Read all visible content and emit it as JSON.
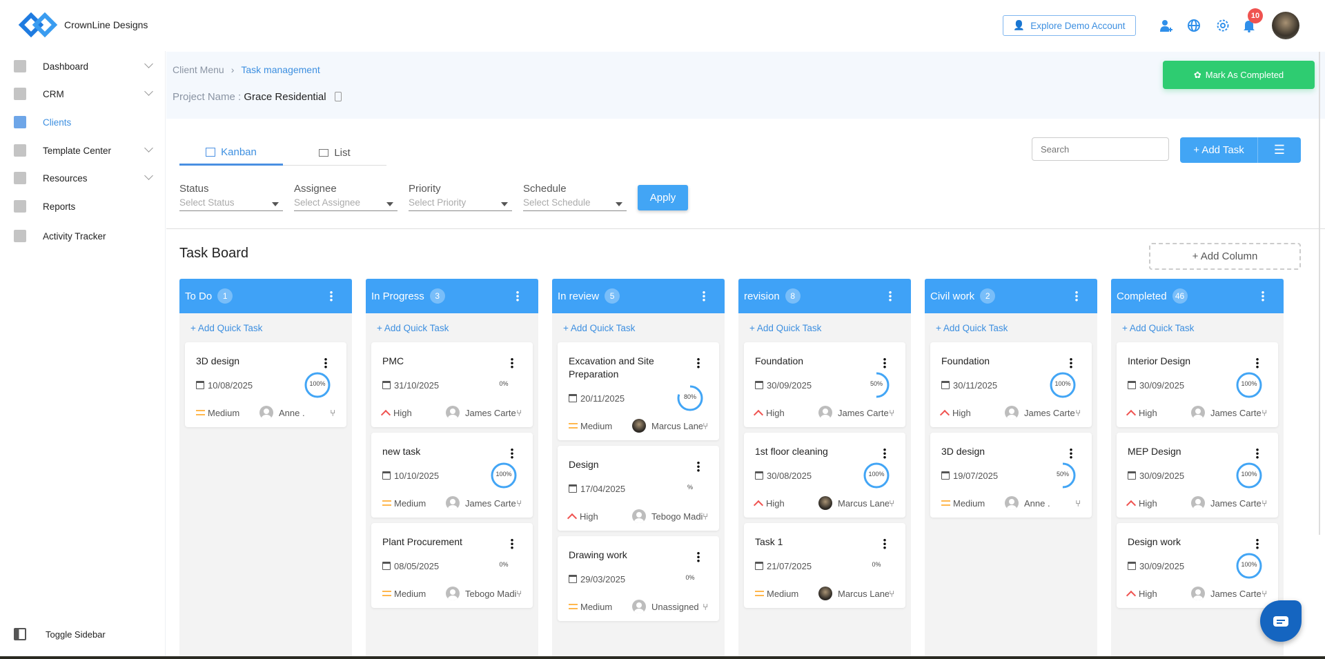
{
  "header": {
    "brand": "CrownLine Designs",
    "demo_button": "Explore Demo Account",
    "notification_count": "10"
  },
  "sidebar": {
    "items": [
      {
        "label": "Dashboard",
        "chevron": true
      },
      {
        "label": "CRM",
        "chevron": true
      },
      {
        "label": "Clients",
        "chevron": false,
        "active": true
      },
      {
        "label": "Template Center",
        "chevron": true
      },
      {
        "label": "Resources",
        "chevron": true
      },
      {
        "label": "Reports",
        "chevron": false
      },
      {
        "label": "Activity Tracker",
        "chevron": false
      }
    ],
    "toggle": "Toggle Sidebar"
  },
  "breadcrumb": {
    "parent": "Client Menu",
    "current": "Task management"
  },
  "project": {
    "label": "Project Name :",
    "name": "Grace Residential"
  },
  "mark_completed": "Mark As Completed",
  "tabs": [
    {
      "label": "Kanban",
      "active": true
    },
    {
      "label": "List",
      "active": false
    }
  ],
  "filters": [
    {
      "label": "Status",
      "placeholder": "Select Status"
    },
    {
      "label": "Assignee",
      "placeholder": "Select Assignee"
    },
    {
      "label": "Priority",
      "placeholder": "Select Priority"
    },
    {
      "label": "Schedule",
      "placeholder": "Select Schedule"
    }
  ],
  "apply": "Apply",
  "search": {
    "placeholder": "Search"
  },
  "add_task": "+ Add Task",
  "board": {
    "title": "Task Board",
    "add_column": "+ Add Column",
    "quick_task": "+ Add Quick Task"
  },
  "colors": {
    "accent": "#3fa2f7",
    "green": "#2ecc71",
    "high": "#ef5350",
    "medium": "#ffb74d"
  },
  "columns": [
    {
      "name": "To Do",
      "count": "1",
      "cards": [
        {
          "title": "3D design",
          "date": "10/08/2025",
          "progress": 100,
          "progress_label": "100%",
          "priority": "Medium",
          "assignee": "Anne .",
          "photo": false
        }
      ]
    },
    {
      "name": "In Progress",
      "count": "3",
      "cards": [
        {
          "title": "PMC",
          "date": "31/10/2025",
          "progress": 0,
          "progress_label": "0%",
          "priority": "High",
          "assignee": "James Carter",
          "photo": false
        },
        {
          "title": "new task",
          "date": "10/10/2025",
          "progress": 100,
          "progress_label": "100%",
          "priority": "Medium",
          "assignee": "James Carter",
          "photo": false
        },
        {
          "title": "Plant Procurement",
          "date": "08/05/2025",
          "progress": 0,
          "progress_label": "0%",
          "priority": "Medium",
          "assignee": "Tebogo Madi",
          "photo": false
        }
      ]
    },
    {
      "name": "In review",
      "count": "5",
      "cards": [
        {
          "title": "Excavation and Site Preparation",
          "date": "20/11/2025",
          "progress": 80,
          "progress_label": "80%",
          "priority": "Medium",
          "assignee": "Marcus Lane",
          "photo": true
        },
        {
          "title": "Design",
          "date": "17/04/2025",
          "progress": 0,
          "progress_label": "%",
          "priority": "High",
          "assignee": "Tebogo Madi",
          "photo": false
        },
        {
          "title": "Drawing work",
          "date": "29/03/2025",
          "progress": 0,
          "progress_label": "0%",
          "priority": "Medium",
          "assignee": "Unassigned",
          "photo": false
        }
      ]
    },
    {
      "name": "revision",
      "count": "8",
      "cards": [
        {
          "title": "Foundation",
          "date": "30/09/2025",
          "progress": 50,
          "progress_label": "50%",
          "priority": "High",
          "assignee": "James Carter",
          "photo": false
        },
        {
          "title": "1st floor cleaning",
          "date": "30/08/2025",
          "progress": 100,
          "progress_label": "100%",
          "priority": "High",
          "assignee": "Marcus Lane",
          "photo": true
        },
        {
          "title": "Task 1",
          "date": "21/07/2025",
          "progress": 0,
          "progress_label": "0%",
          "priority": "Medium",
          "assignee": "Marcus Lane",
          "photo": true
        }
      ]
    },
    {
      "name": "Civil work",
      "count": "2",
      "cards": [
        {
          "title": "Foundation",
          "date": "30/11/2025",
          "progress": 100,
          "progress_label": "100%",
          "priority": "High",
          "assignee": "James Carter",
          "photo": false
        },
        {
          "title": "3D design",
          "date": "19/07/2025",
          "progress": 50,
          "progress_label": "50%",
          "priority": "Medium",
          "assignee": "Anne .",
          "photo": false
        }
      ]
    },
    {
      "name": "Completed",
      "count": "46",
      "cards": [
        {
          "title": "Interior Design",
          "date": "30/09/2025",
          "progress": 100,
          "progress_label": "100%",
          "priority": "High",
          "assignee": "James Carter",
          "photo": false
        },
        {
          "title": "MEP Design",
          "date": "30/09/2025",
          "progress": 100,
          "progress_label": "100%",
          "priority": "High",
          "assignee": "James Carter",
          "photo": false
        },
        {
          "title": "Design work",
          "date": "30/09/2025",
          "progress": 100,
          "progress_label": "100%",
          "priority": "High",
          "assignee": "James Carter",
          "photo": false
        }
      ]
    }
  ]
}
